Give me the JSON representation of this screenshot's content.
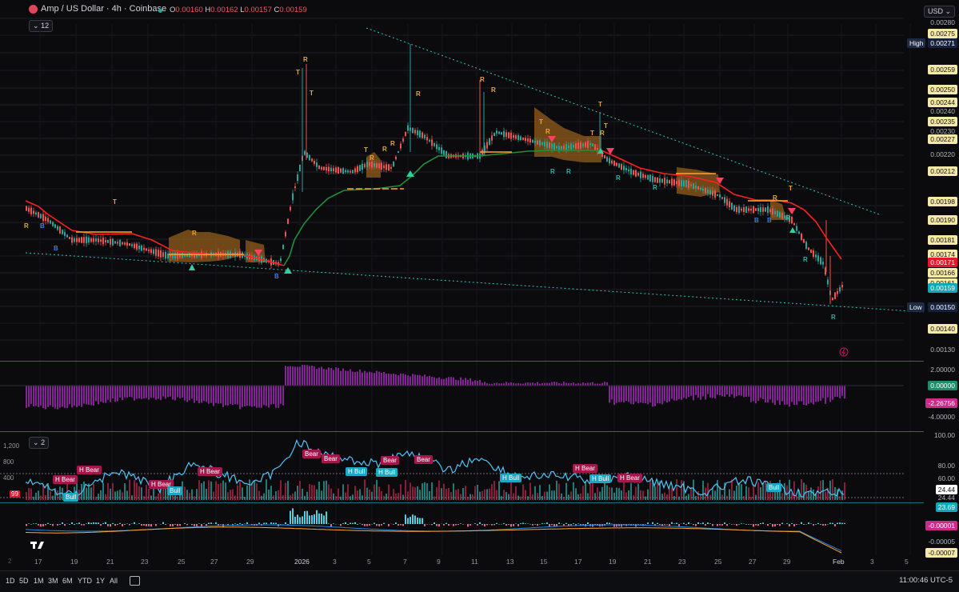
{
  "header": {
    "symbol_title": "Amp / US Dollar · 4h · Coinbase",
    "ohlc": [
      {
        "k": "O",
        "v": "0.00160"
      },
      {
        "k": "H",
        "v": "0.00162"
      },
      {
        "k": "L",
        "v": "0.00157"
      },
      {
        "k": "C",
        "v": "0.00159"
      }
    ],
    "indicator_count": "12",
    "currency": "USD"
  },
  "price_axis": {
    "labels": [
      {
        "text": "0.00280",
        "style": "plain"
      },
      {
        "text": "0.00275",
        "style": "y"
      },
      {
        "text": "0.00271",
        "style": "navy"
      },
      {
        "text": "0.00259",
        "style": "y"
      },
      {
        "text": "0.00250",
        "style": "y"
      },
      {
        "text": "0.00244",
        "style": "y"
      },
      {
        "text": "0.00240",
        "style": "plain"
      },
      {
        "text": "0.00235",
        "style": "y"
      },
      {
        "text": "0.00230",
        "style": "plain"
      },
      {
        "text": "0.00227",
        "style": "y"
      },
      {
        "text": "0.00220",
        "style": "plain"
      },
      {
        "text": "0.00212",
        "style": "y"
      },
      {
        "text": "0.00198",
        "style": "y"
      },
      {
        "text": "0.00190",
        "style": "y"
      },
      {
        "text": "0.00181",
        "style": "y"
      },
      {
        "text": "0.00174",
        "style": "y"
      },
      {
        "text": "0.00171",
        "style": "red"
      },
      {
        "text": "0.00166",
        "style": "y"
      },
      {
        "text": "0.00161",
        "style": "y"
      },
      {
        "text": "0.00159",
        "style": "teal"
      },
      {
        "text": "0.00150",
        "style": "navy"
      },
      {
        "text": "0.00140",
        "style": "y"
      },
      {
        "text": "0.00130",
        "style": "plain"
      }
    ],
    "high_tag": "High",
    "low_tag": "Low"
  },
  "momentum_axis": {
    "labels": [
      {
        "text": "2.00000",
        "style": "plain"
      },
      {
        "text": "0.00000",
        "style": "green"
      },
      {
        "text": "-2.26756",
        "style": "pink"
      },
      {
        "text": "-4.00000",
        "style": "plain"
      }
    ]
  },
  "rsi_panel": {
    "indicator_count": "2",
    "left_labels": [
      "1,200",
      "800",
      "400"
    ],
    "left_value": "99",
    "right_labels": [
      {
        "text": "100.00",
        "style": "plain"
      },
      {
        "text": "80.00",
        "style": "plain"
      },
      {
        "text": "60.00",
        "style": "plain"
      },
      {
        "text": "24.44",
        "style": "white"
      },
      {
        "text": "24.44",
        "style": "plain"
      },
      {
        "text": "23.69",
        "style": "teal"
      }
    ],
    "chips": [
      {
        "text": "H Bear",
        "type": "bear"
      },
      {
        "text": "H Bear",
        "type": "bear"
      },
      {
        "text": "Bull",
        "type": "bull"
      },
      {
        "text": "H Bear",
        "type": "bear"
      },
      {
        "text": "Bull",
        "type": "bull"
      },
      {
        "text": "H Bear",
        "type": "bear"
      },
      {
        "text": "Bear",
        "type": "bear"
      },
      {
        "text": "Bear",
        "type": "bear"
      },
      {
        "text": "H Bull",
        "type": "bull"
      },
      {
        "text": "H Bull",
        "type": "bull"
      },
      {
        "text": "Bear",
        "type": "bear"
      },
      {
        "text": "Bear",
        "type": "bear"
      },
      {
        "text": "H Bull",
        "type": "bull"
      },
      {
        "text": "H Bear",
        "type": "bear"
      },
      {
        "text": "H Bull",
        "type": "bull"
      },
      {
        "text": "H Bear",
        "type": "bear"
      },
      {
        "text": "Bull",
        "type": "bull"
      }
    ]
  },
  "macd_axis": {
    "labels": [
      {
        "text": "-0.00001",
        "style": "pink"
      },
      {
        "text": "-0.00005",
        "style": "plain"
      },
      {
        "text": "-0.00007",
        "style": "y"
      }
    ]
  },
  "time_axis": [
    "17",
    "19",
    "21",
    "23",
    "25",
    "27",
    "29",
    "2026",
    "3",
    "5",
    "7",
    "9",
    "11",
    "13",
    "15",
    "17",
    "19",
    "21",
    "23",
    "25",
    "27",
    "29",
    "Feb",
    "3",
    "5"
  ],
  "timeframes": [
    "1D",
    "5D",
    "1M",
    "3M",
    "6M",
    "YTD",
    "1Y",
    "All"
  ],
  "clock": "11:00:46 UTC-5",
  "colors": {
    "bg": "#0b0b0e",
    "candle_up": "#26a69a",
    "candle_down": "#ef5350",
    "ma_red": "#ff1f1f",
    "ma_green": "#1f8f3a",
    "trend": "#2ec4b6",
    "zone": "#c47a1f"
  },
  "signals": {
    "R": "R",
    "T": "T",
    "B": "B"
  }
}
